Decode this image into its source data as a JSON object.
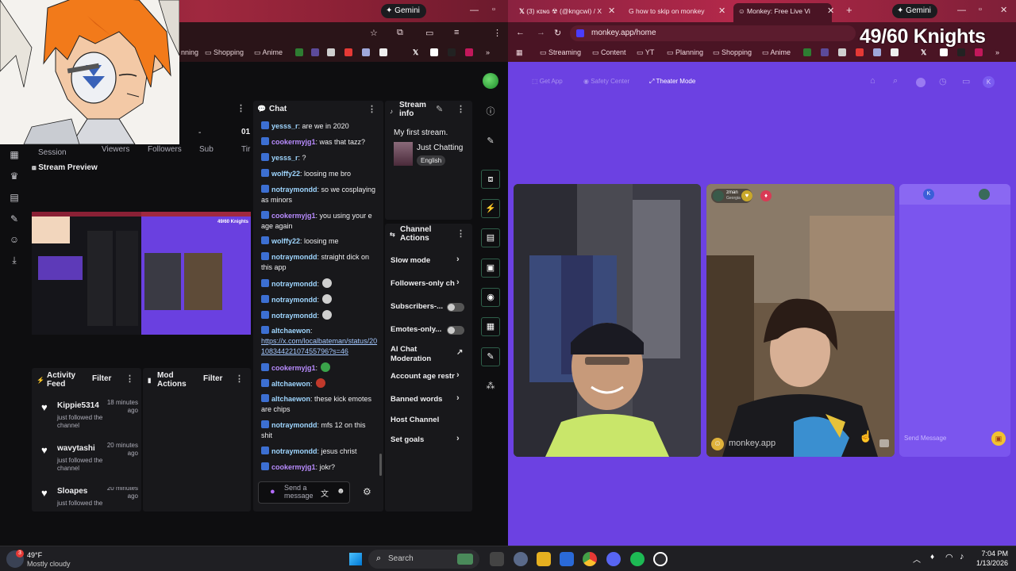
{
  "left_browser": {
    "gemini_label": "Gemini",
    "bookmarks": [
      "nning",
      "Shopping",
      "Anime"
    ]
  },
  "dashboard": {
    "stats": {
      "session_label": "Session",
      "viewers_label": "Viewers",
      "followers_label": "Followers",
      "subs_label": "Sub",
      "extra_label": "Tir",
      "viewers_value": "-",
      "followers_value": "01"
    },
    "stream_preview_title": "Stream Preview",
    "activity_feed": {
      "title": "Activity Feed",
      "filter_label": "Filter",
      "items": [
        {
          "name": "Kippie5314",
          "time": "18 minutes ago",
          "desc": "just followed the channel"
        },
        {
          "name": "wavytashi",
          "time": "20 minutes ago",
          "desc": "just followed the channel"
        },
        {
          "name": "Sloapes",
          "time": "20 minutes ago",
          "desc": "just followed the"
        }
      ]
    },
    "mod_actions": {
      "title": "Mod Actions",
      "filter_label": "Filter"
    },
    "chat": {
      "title": "Chat",
      "messages": [
        {
          "user": "yesss_r",
          "text": ": are we in 2020",
          "color": "#9fd6ff"
        },
        {
          "user": "cookermyjg1",
          "text": ": was that tazz?",
          "color": "#b98cff"
        },
        {
          "user": "yesss_r",
          "text": ": ?",
          "color": "#9fd6ff"
        },
        {
          "user": "wolffy22",
          "text": ": loosing me bro",
          "color": "#9fd6ff"
        },
        {
          "user": "notraymondd",
          "text": ": so we cosplaying as minors",
          "color": "#9fd6ff"
        },
        {
          "user": "cookermyjg1",
          "text": ": you using your e age again",
          "color": "#b98cff"
        },
        {
          "user": "wolffy22",
          "text": ": loosing me",
          "color": "#9fd6ff"
        },
        {
          "user": "notraymondd",
          "text": ": straight dick on this app",
          "color": "#9fd6ff"
        },
        {
          "user": "notraymondd",
          "text": ":",
          "color": "#9fd6ff"
        },
        {
          "user": "notraymondd",
          "text": ":",
          "color": "#9fd6ff"
        },
        {
          "user": "notraymondd",
          "text": ":",
          "color": "#9fd6ff"
        },
        {
          "user": "altchaewon",
          "text": ":",
          "color": "#9fd6ff"
        },
        {
          "user": "cookermyjg1",
          "text": ":",
          "color": "#b98cff"
        },
        {
          "user": "altchaewon",
          "text": ":",
          "color": "#9fd6ff"
        },
        {
          "user": "altchaewon",
          "text": ": these kick emotes are chips",
          "color": "#9fd6ff"
        },
        {
          "user": "notraymondd",
          "text": ": mfs 12 on this shit",
          "color": "#9fd6ff"
        },
        {
          "user": "notraymondd",
          "text": ": jesus christ",
          "color": "#9fd6ff"
        },
        {
          "user": "cookermyjg1",
          "text": ": jokr?",
          "color": "#b98cff"
        }
      ],
      "link": "https://x.com/localbateman/status/2010834422107455796?s=46",
      "input_placeholder": "Send a message"
    },
    "stream_info": {
      "title": "Stream info",
      "stream_title": "My first stream.",
      "category": "Just Chatting",
      "language": "English"
    },
    "channel_actions": {
      "title": "Channel Actions",
      "items": [
        "Slow mode",
        "Followers-only ch",
        "Subscribers-...",
        "Emotes-only...",
        "AI Chat Moderation",
        "Account age restr",
        "Banned words",
        "Host Channel",
        "Set goals"
      ]
    },
    "avatar_overlay": "49/60 Knights"
  },
  "right_browser": {
    "tabs": [
      {
        "label": "(3) ᴋɪɴɢ ☢ (@kngcwi) / X"
      },
      {
        "label": "how to skip on monkey"
      },
      {
        "label": "Monkey: Free Live Vi"
      }
    ],
    "gemini_label": "Gemini",
    "url": "monkey.app/home",
    "bookmarks": [
      "Streaming",
      "Content",
      "YT",
      "Planning",
      "Shopping",
      "Anime"
    ],
    "overlay_text": "49/60 Knights"
  },
  "monkey": {
    "nav": {
      "get_app": "Get App",
      "safety": "Safety Center",
      "theater": "Theater Mode"
    },
    "profile_initial": "K",
    "partner": {
      "name": "zman",
      "location": "Georgia"
    },
    "watermark": "monkey.app",
    "send_placeholder": "Send Message"
  },
  "taskbar": {
    "weather_temp": "49°F",
    "weather_desc": "Mostly cloudy",
    "weather_badge": "3",
    "search_label": "Search",
    "time": "7:04 PM",
    "date": "1/13/2026"
  }
}
